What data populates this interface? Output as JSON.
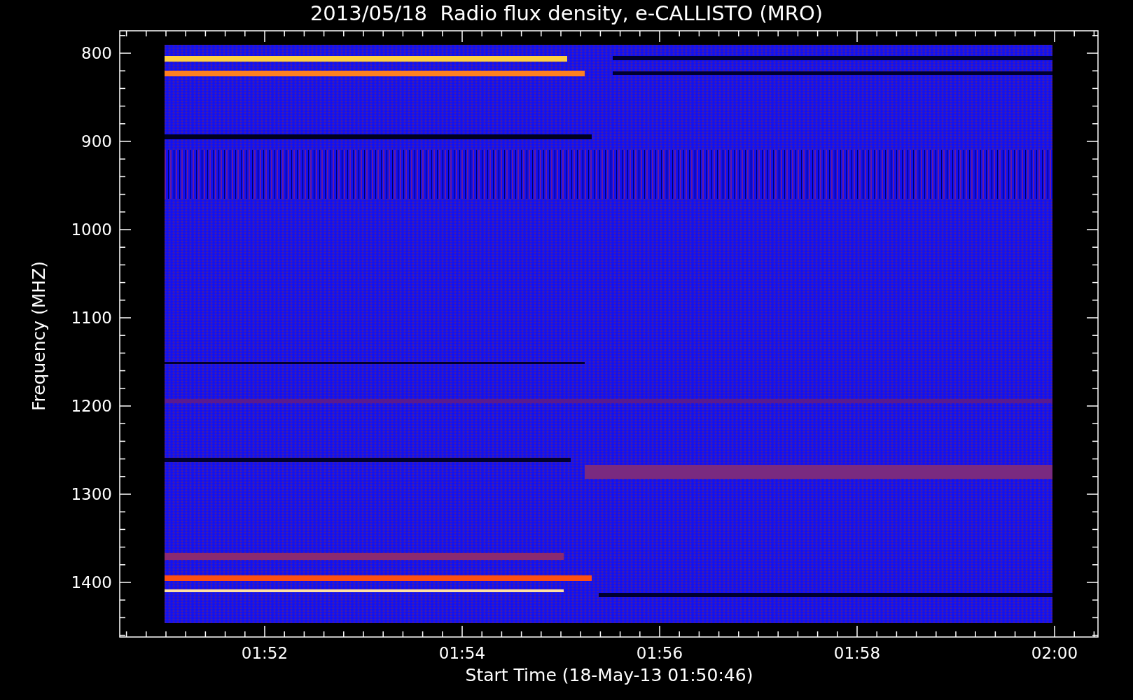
{
  "title": "2013/05/18  Radio flux density, e-CALLISTO (MRO)",
  "y_axis": {
    "label": "Frequency (MHZ)",
    "ticks": [
      "800",
      "900",
      "1000",
      "1100",
      "1200",
      "1300",
      "1400"
    ]
  },
  "x_axis": {
    "label": "Start Time (18-May-13 01:50:46)",
    "ticks": [
      "01:52",
      "01:54",
      "01:56",
      "01:58",
      "02:00"
    ]
  }
}
